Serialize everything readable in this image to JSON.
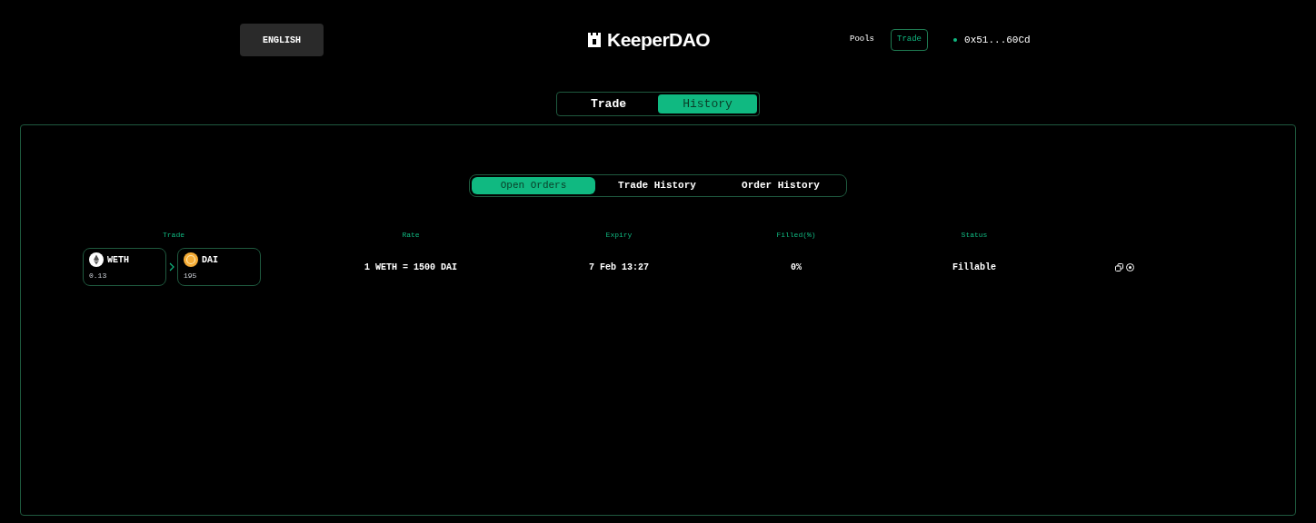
{
  "language_button": "ENGLISH",
  "logo": {
    "text": "KeeperDAO"
  },
  "nav": [
    {
      "label": "Pools",
      "selected": false
    },
    {
      "label": "Trade",
      "selected": true
    }
  ],
  "wallet": {
    "address": "0x51...60Cd",
    "connected": true
  },
  "main_tabs": [
    {
      "label": "Trade",
      "selected": false
    },
    {
      "label": "History",
      "selected": true
    }
  ],
  "order_tabs": [
    {
      "label": "Open Orders",
      "selected": true
    },
    {
      "label": "Trade History",
      "selected": false
    },
    {
      "label": "Order History",
      "selected": false
    }
  ],
  "table": {
    "columns": [
      "Trade",
      "Rate",
      "Expiry",
      "Filled(%)",
      "Status"
    ],
    "rows": [
      {
        "from": {
          "token": "WETH",
          "amount": "0.13",
          "kind": "eth"
        },
        "to": {
          "token": "DAI",
          "amount": "195",
          "kind": "dai"
        },
        "rate": "1 WETH = 1500 DAI",
        "expiry": "7 Feb 13:27",
        "filled": "0%",
        "status": "Fillable"
      }
    ]
  }
}
